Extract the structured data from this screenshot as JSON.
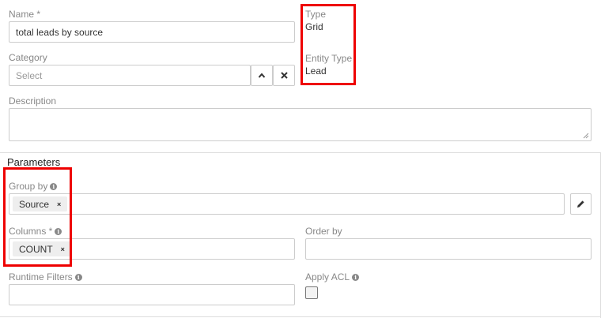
{
  "general": {
    "name_label": "Name *",
    "name_value": "total leads by source",
    "category_label": "Category",
    "category_placeholder": "Select",
    "description_label": "Description",
    "description_value": "",
    "type_label": "Type",
    "type_value": "Grid",
    "entity_type_label": "Entity Type",
    "entity_type_value": "Lead"
  },
  "parameters": {
    "section_title": "Parameters",
    "group_by_label": "Group by",
    "group_by_tags": [
      "Source"
    ],
    "columns_label": "Columns *",
    "columns_tags": [
      "COUNT"
    ],
    "order_by_label": "Order by",
    "runtime_filters_label": "Runtime Filters",
    "apply_acl_label": "Apply ACL",
    "apply_acl_checked": false
  },
  "icons": {
    "tag_remove": "×",
    "info": "i",
    "chevron_up": "chevron-up-icon",
    "clear": "close-icon",
    "edit": "pencil-icon"
  },
  "colors": {
    "highlight": "#e00000",
    "label": "#888888",
    "border": "#cccccc"
  }
}
